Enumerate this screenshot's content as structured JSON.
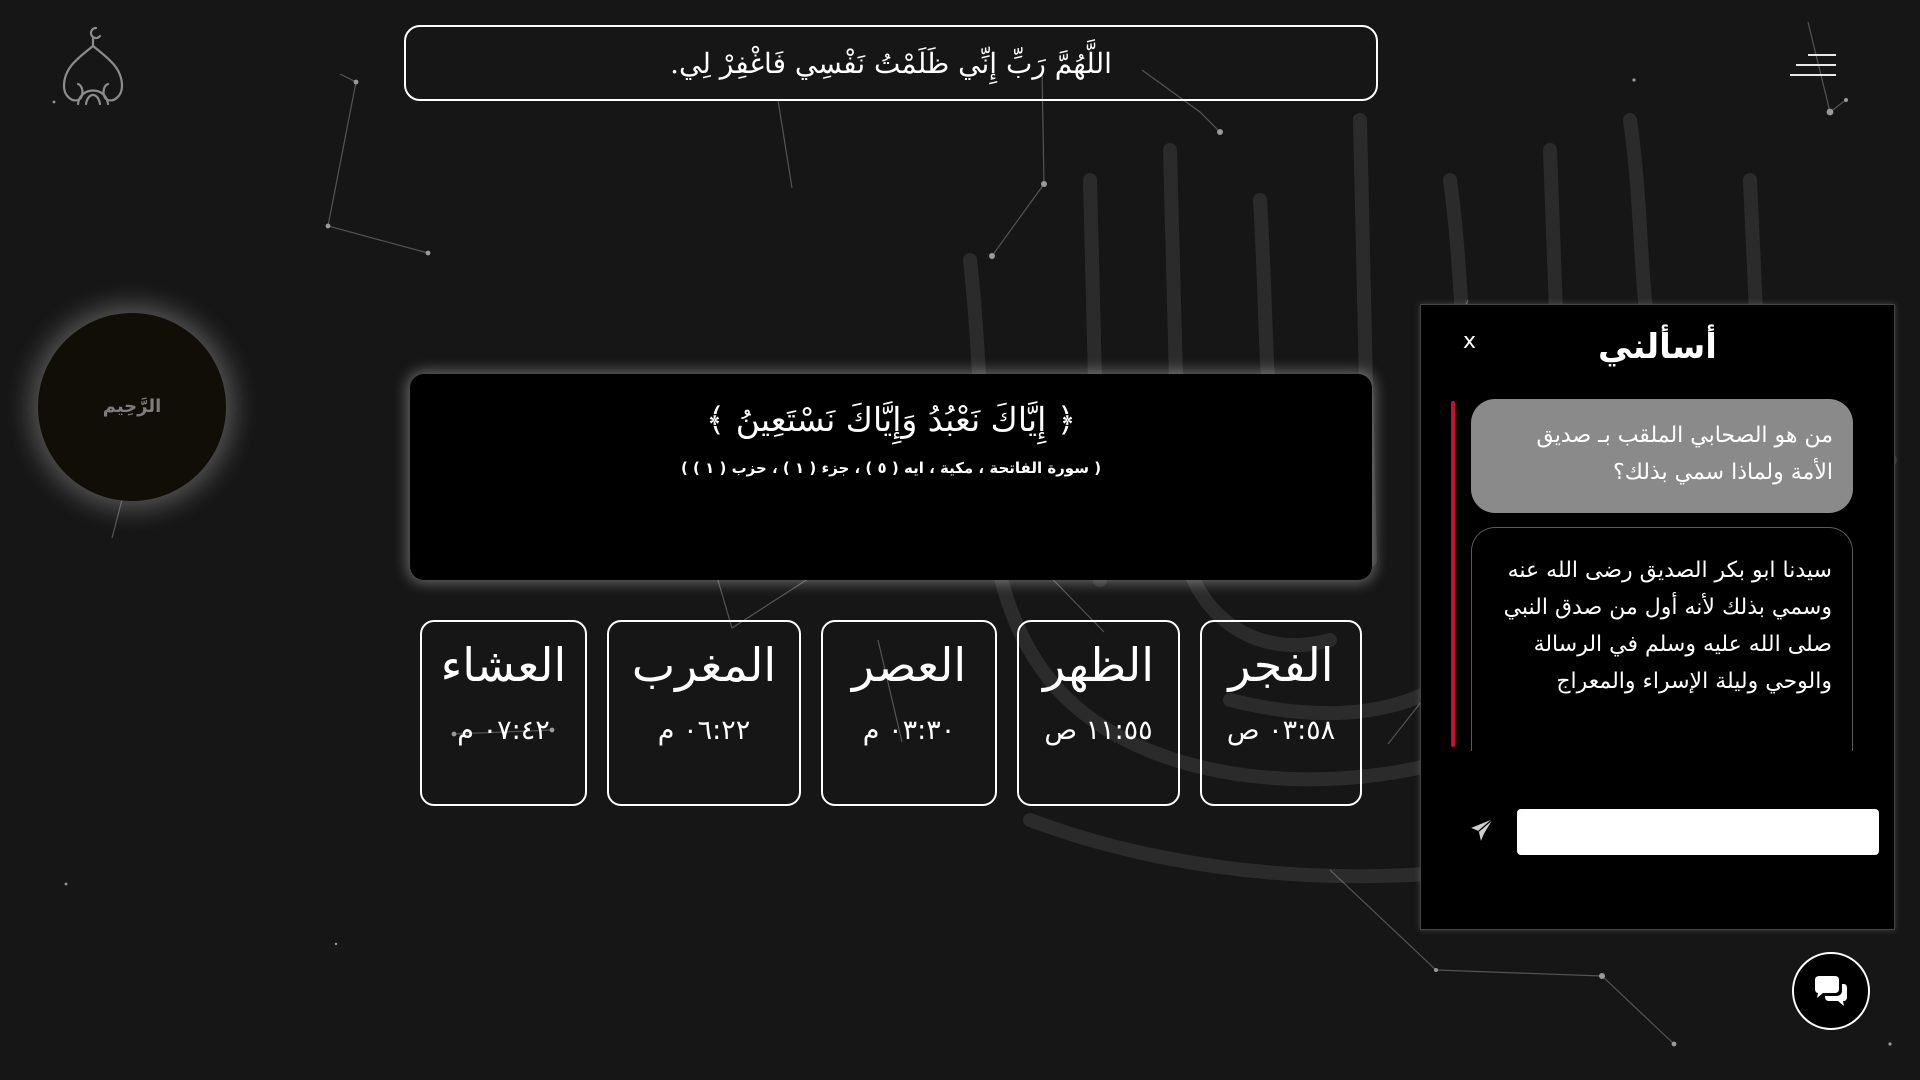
{
  "header": {
    "dua": "اللَّهُمَّ رَبِّ إِنِّي ظَلَمْتُ نَفْسِي فَاغْفِرْ لِي."
  },
  "orb": {
    "label": "الرَّحِيم"
  },
  "ayah": {
    "text": "﴿ إِيَّاكَ نَعْبُدُ وَإِيَّاكَ نَسْتَعِينُ ﴾",
    "reference": "( سورة الفاتحة ، مكية ، ايه ( ٥ ) ، جزء ( ١ ) ، حزب ( ١ ) )"
  },
  "prayers": [
    {
      "name": "الفجر",
      "time": "٠٣:٥٨ ص"
    },
    {
      "name": "الظهر",
      "time": "١١:٥٥ ص"
    },
    {
      "name": "العصر",
      "time": "٠٣:٣٠ م"
    },
    {
      "name": "المغرب",
      "time": "٠٦:٢٢ م"
    },
    {
      "name": "العشاء",
      "time": "٠٧:٤٢ م"
    }
  ],
  "chat": {
    "title": "أسألني",
    "close_label": "x",
    "messages": [
      {
        "role": "user",
        "text": "من هو الصحابي الملقب بـ صديق الأمة ولماذا سمي بذلك؟"
      },
      {
        "role": "bot",
        "text": "سيدنا ابو بكر الصديق رضى الله عنه وسمي بذلك لأنه أول من صدق النبي صلى الله عليه وسلم في الرسالة والوحي وليلة الإسراء والمعراج"
      }
    ],
    "input_value": "",
    "input_placeholder": "",
    "accent_color": "#c8102e"
  },
  "icons": {
    "logo": "mosque-dome-icon",
    "menu": "hamburger-menu-icon",
    "send": "paper-plane-icon",
    "chat_toggle": "chat-bubbles-icon"
  }
}
